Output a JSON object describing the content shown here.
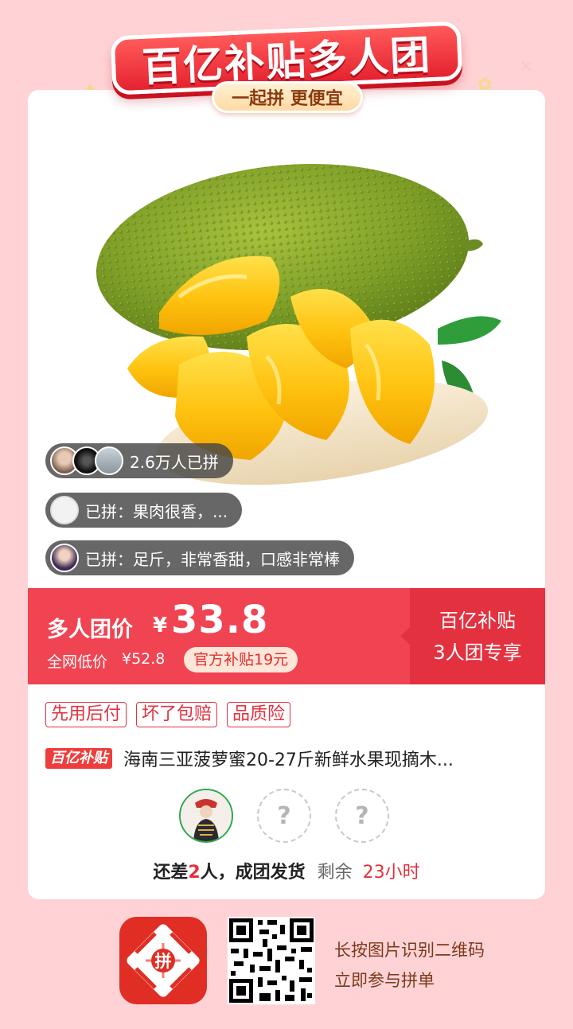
{
  "banner": {
    "title": "百亿补贴多人团",
    "subtitle": "一起拼 更便宜"
  },
  "social": {
    "joined_count": "2.6万人已拼",
    "review_1": "已拼：果肉很香，...",
    "review_2": "已拼：足斤，非常香甜，口感非常棒"
  },
  "price": {
    "label": "多人团价",
    "currency": "¥",
    "value": "33.8",
    "original_label": "全网低价",
    "original_value": "¥52.8",
    "subsidy": "官方补贴19元",
    "side_line1": "百亿补贴",
    "side_line2": "3人团专享"
  },
  "tags": [
    "先用后付",
    "坏了包赔",
    "品质险"
  ],
  "product": {
    "badge": "百亿补贴",
    "title": "海南三亚菠萝蜜20-27斤新鲜水果现摘木..."
  },
  "group": {
    "missing_placeholder": "?",
    "status_prefix": "还差",
    "status_count": "2",
    "status_suffix": "人，成团发货",
    "remaining_label": "剩余",
    "remaining_time": "23小时"
  },
  "footer": {
    "logo_text": "拼",
    "line1": "长按图片识别二维码",
    "line2": "立即参与拼单"
  },
  "colors": {
    "accent_red": "#f04452",
    "dark_red": "#e3313f",
    "background_pink": "#ffd3d6",
    "success_green": "#2fa84f"
  }
}
